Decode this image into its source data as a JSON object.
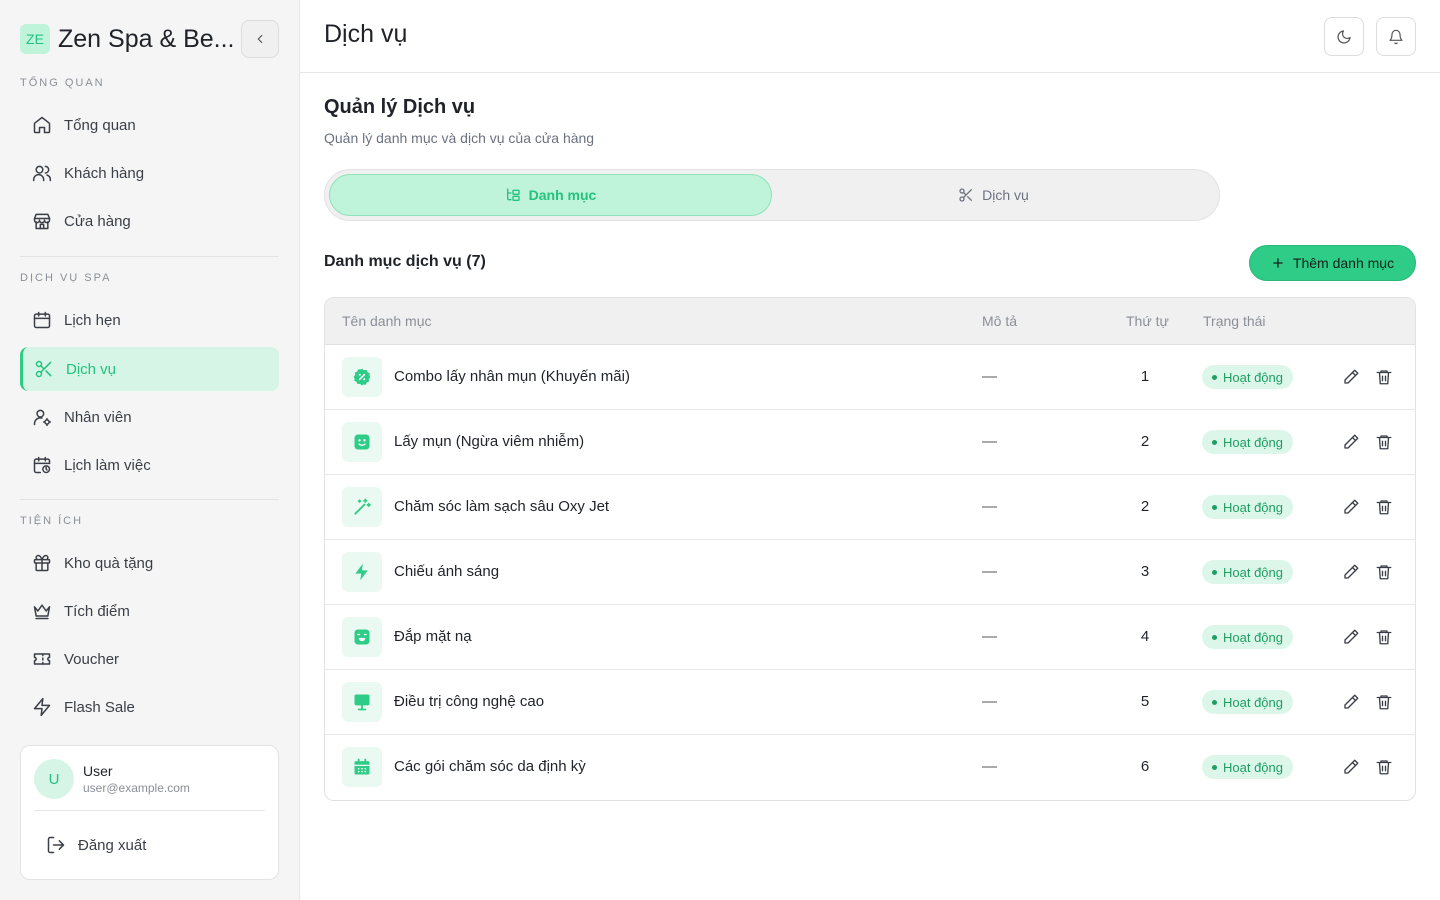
{
  "app": {
    "logo_text": "ZE",
    "brand_name": "Zen Spa & Be..."
  },
  "sidebar": {
    "sections": [
      {
        "title": "TỔNG QUAN"
      },
      {
        "title": "DỊCH VỤ SPA"
      },
      {
        "title": "TIỆN ÍCH"
      }
    ],
    "items": [
      {
        "label": "Tổng quan",
        "icon": "home-icon"
      },
      {
        "label": "Khách hàng",
        "icon": "users-icon"
      },
      {
        "label": "Cửa hàng",
        "icon": "store-icon"
      },
      {
        "label": "Lịch hẹn",
        "icon": "calendar-icon"
      },
      {
        "label": "Dịch vụ",
        "icon": "scissors-icon",
        "active": true
      },
      {
        "label": "Nhân viên",
        "icon": "user-cog-icon"
      },
      {
        "label": "Lịch làm việc",
        "icon": "calendar-clock-icon"
      },
      {
        "label": "Kho quà tặng",
        "icon": "gift-icon"
      },
      {
        "label": "Tích điểm",
        "icon": "crown-icon"
      },
      {
        "label": "Voucher",
        "icon": "ticket-icon"
      },
      {
        "label": "Flash Sale",
        "icon": "zap-icon"
      }
    ],
    "user": {
      "initial": "U",
      "name": "User",
      "email": "user@example.com",
      "logout_label": "Đăng xuất"
    }
  },
  "header": {
    "title": "Dịch vụ"
  },
  "main": {
    "title": "Quản lý Dịch vụ",
    "subtitle": "Quản lý danh mục và dịch vụ của cửa hàng",
    "tabs": [
      {
        "label": "Danh mục",
        "icon": "tree-icon",
        "active": true
      },
      {
        "label": "Dịch vụ",
        "icon": "scissors-icon",
        "active": false
      }
    ],
    "list_title": "Danh mục dịch vụ (7)",
    "add_button_label": "Thêm danh mục",
    "table": {
      "columns": [
        "Tên danh mục",
        "Mô tả",
        "Thứ tự",
        "Trạng thái"
      ],
      "rows": [
        {
          "icon": "badge-percent-icon",
          "name": "Combo lấy nhân mụn (Khuyến mãi)",
          "desc": "—",
          "order": "1",
          "status": "Hoạt động"
        },
        {
          "icon": "smile-face-icon",
          "name": "Lấy mụn (Ngừa viêm nhiễm)",
          "desc": "—",
          "order": "2",
          "status": "Hoạt động"
        },
        {
          "icon": "magic-wand-icon",
          "name": "Chăm sóc làm sạch sâu Oxy Jet",
          "desc": "—",
          "order": "2",
          "status": "Hoạt động"
        },
        {
          "icon": "lightning-icon",
          "name": "Chiếu ánh sáng",
          "desc": "—",
          "order": "3",
          "status": "Hoạt động"
        },
        {
          "icon": "face-mask-icon",
          "name": "Đắp mặt nạ",
          "desc": "—",
          "order": "4",
          "status": "Hoạt động"
        },
        {
          "icon": "monitor-icon",
          "name": "Điều trị công nghệ cao",
          "desc": "—",
          "order": "5",
          "status": "Hoạt động"
        },
        {
          "icon": "calendar-icon",
          "name": "Các gói chăm sóc da định kỳ",
          "desc": "—",
          "order": "6",
          "status": "Hoạt động"
        }
      ]
    }
  },
  "colors": {
    "accent": "#2ecc87",
    "accent_light": "#d6f5e6",
    "status_active": "#1f9e63"
  }
}
